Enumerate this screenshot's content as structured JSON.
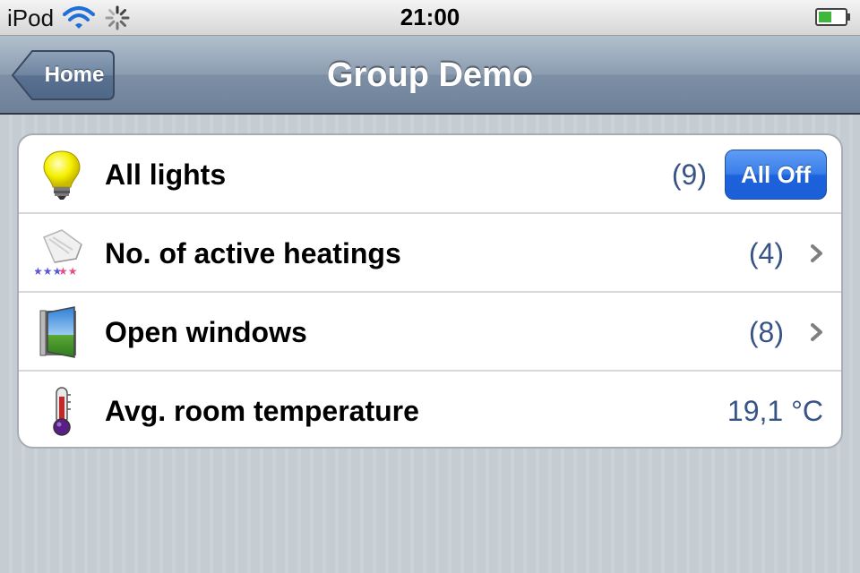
{
  "status_bar": {
    "carrier": "iPod",
    "time": "21:00",
    "wifi_icon": "wifi-icon",
    "activity_icon": "activity-spinner-icon",
    "battery_icon": "battery-icon"
  },
  "nav_bar": {
    "back_label": "Home",
    "title": "Group Demo"
  },
  "rows": [
    {
      "label": "All lights",
      "value": "(9)",
      "action_label": "All Off",
      "icon": "light-bulb-icon"
    },
    {
      "label": "No. of active heatings",
      "value": "(4)",
      "icon": "heater-icon",
      "disclosure": true
    },
    {
      "label": "Open windows",
      "value": "(8)",
      "icon": "window-icon",
      "disclosure": true
    },
    {
      "label": "Avg. room temperature",
      "value": "19,1 °C",
      "icon": "thermometer-icon"
    }
  ],
  "colors": {
    "value_text": "#385487",
    "button_blue": "#1c63dd",
    "nav_bar": "#7d8fa5"
  }
}
